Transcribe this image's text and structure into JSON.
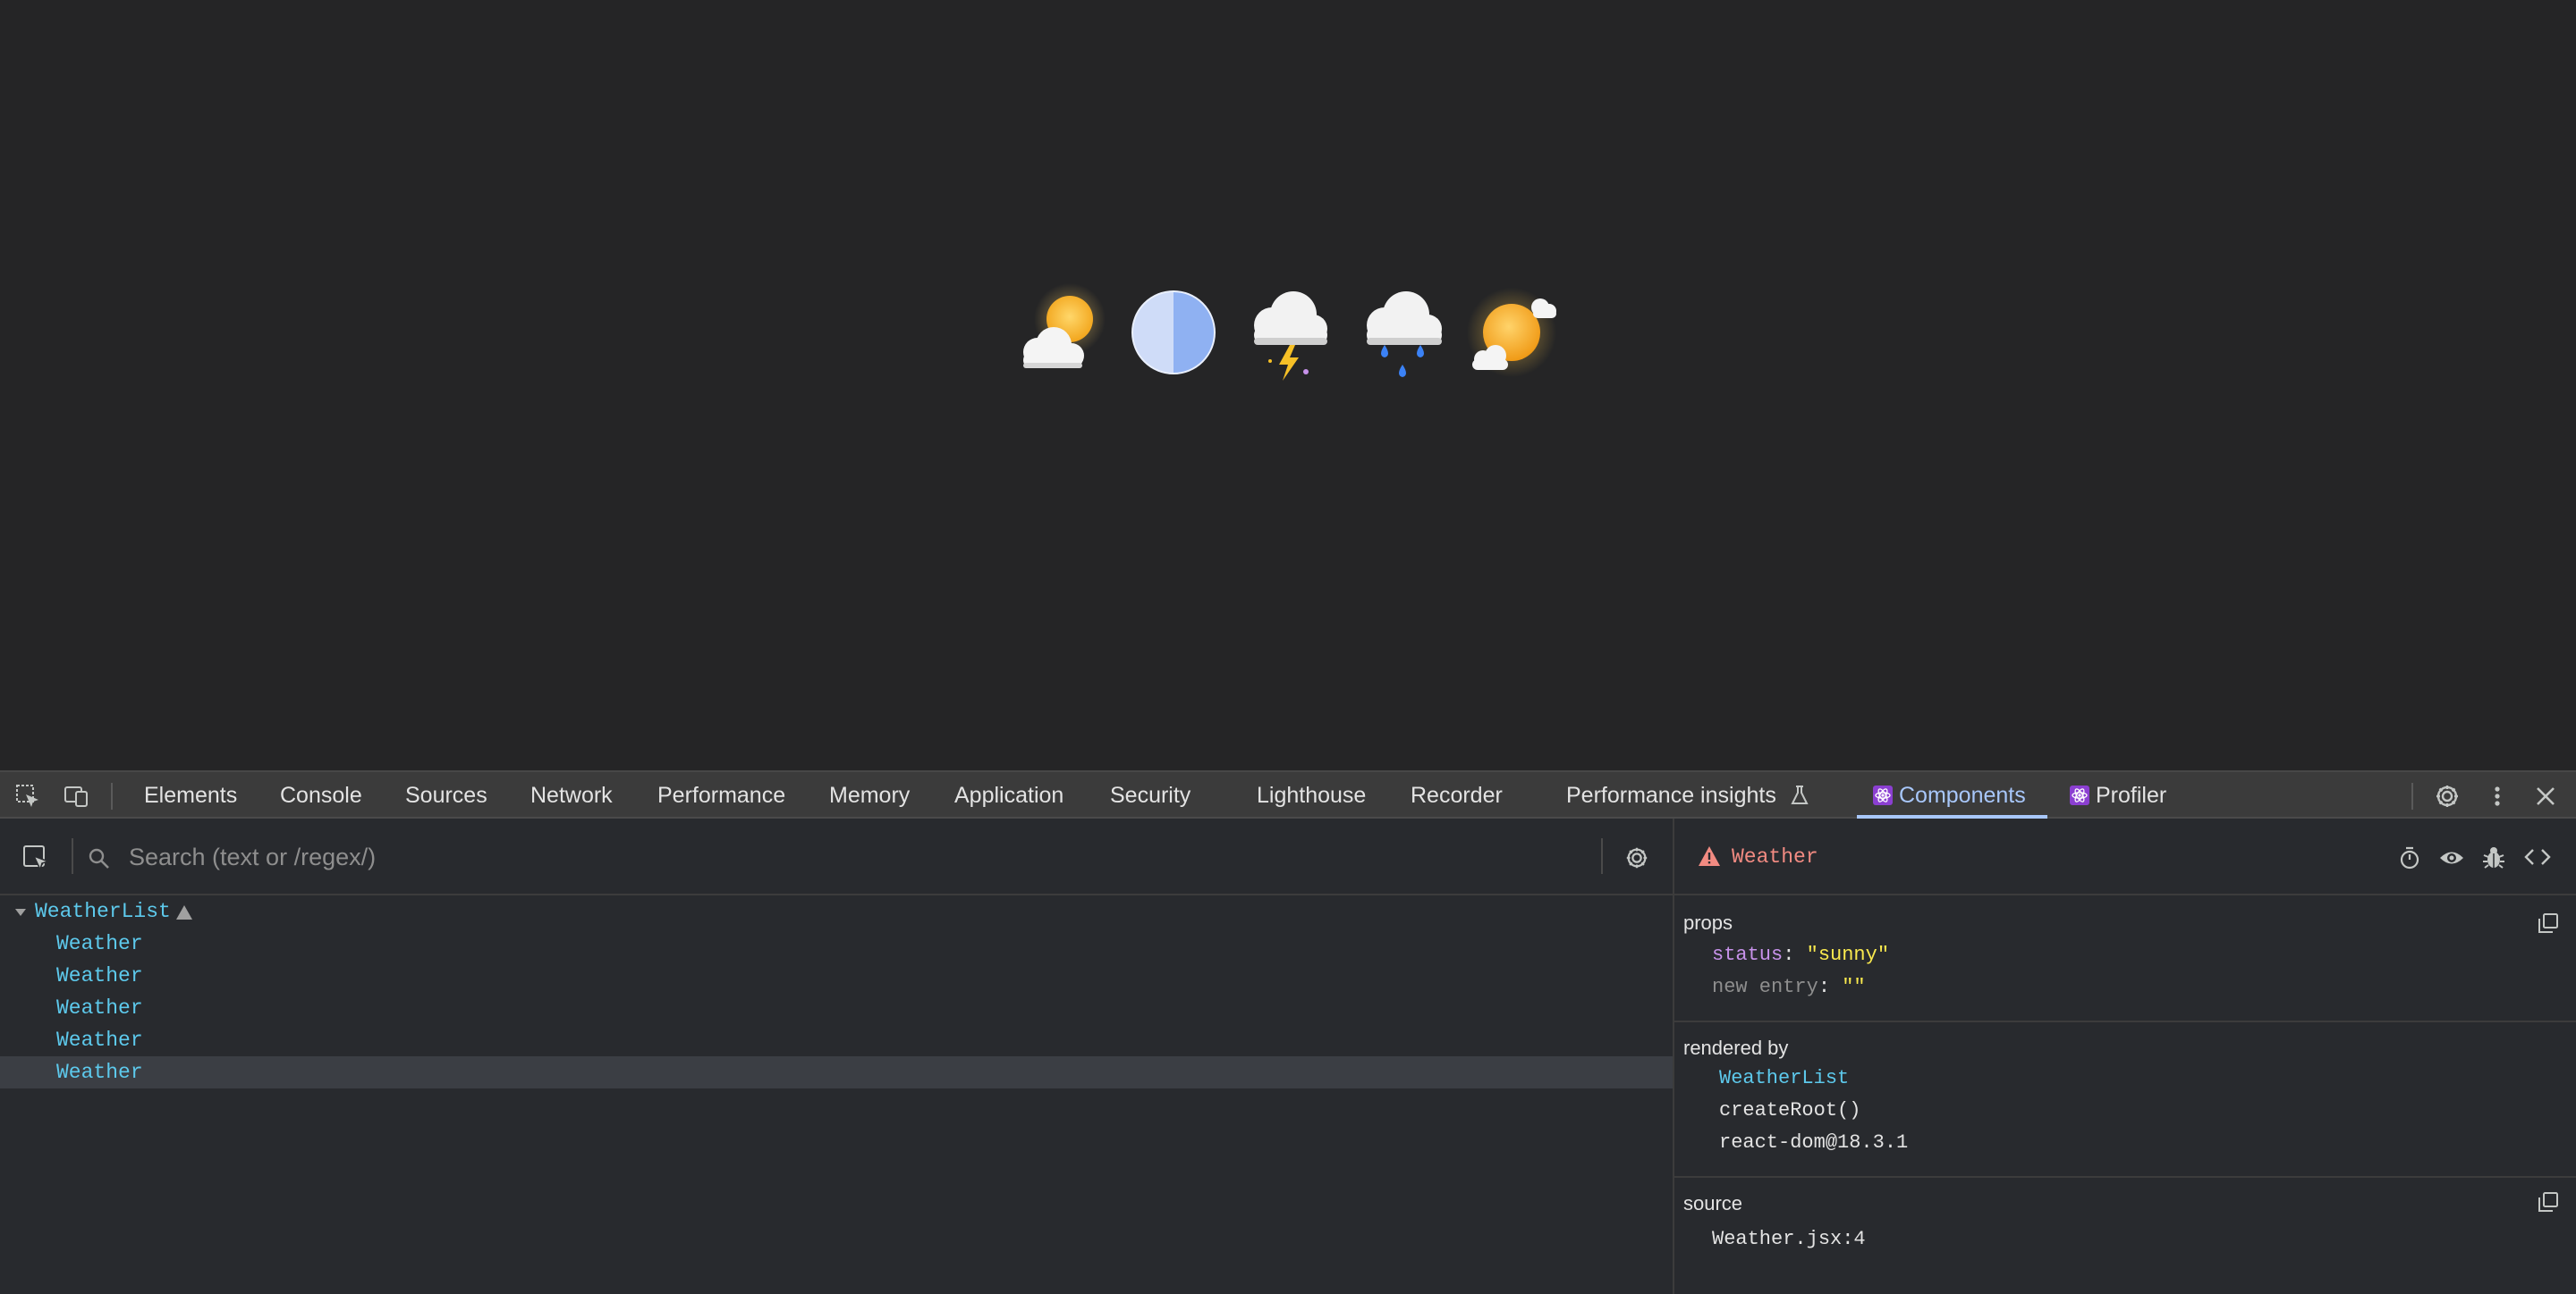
{
  "devtools": {
    "tabs": [
      {
        "label": "Elements"
      },
      {
        "label": "Console"
      },
      {
        "label": "Sources"
      },
      {
        "label": "Network"
      },
      {
        "label": "Performance"
      },
      {
        "label": "Memory"
      },
      {
        "label": "Application"
      },
      {
        "label": "Security"
      },
      {
        "label": "Lighthouse"
      },
      {
        "label": "Recorder"
      },
      {
        "label": "Performance insights"
      },
      {
        "label": "Components"
      },
      {
        "label": "Profiler"
      }
    ],
    "active_tab": "Components"
  },
  "components": {
    "search": {
      "placeholder": "Search (text or /regex/)"
    },
    "tree": [
      {
        "label": "WeatherList",
        "warning": true
      },
      {
        "label": "Weather"
      },
      {
        "label": "Weather"
      },
      {
        "label": "Weather"
      },
      {
        "label": "Weather"
      },
      {
        "label": "Weather",
        "selected": true
      }
    ]
  },
  "inspector": {
    "component_name": "Weather",
    "props_title": "props",
    "props": [
      {
        "key": "status",
        "sep": ": ",
        "value": "\"sunny\""
      },
      {
        "key": "new entry",
        "sep": ": ",
        "value": "\"\""
      }
    ],
    "rendered_by_title": "rendered by",
    "rendered_by": [
      "WeatherList",
      "createRoot()",
      "react-dom@18.3.1"
    ],
    "source_title": "source",
    "source": "Weather.jsx:4"
  },
  "colors": {
    "component_blue": "#5dc9ec",
    "warning_red": "#f28b82",
    "string_yellow": "#f9e94e",
    "prop_key_purple": "#c792ea",
    "active_tab_blue": "#a8c7fa"
  }
}
